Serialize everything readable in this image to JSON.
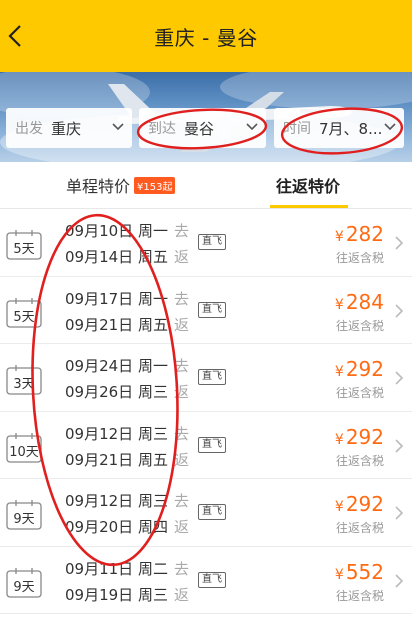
{
  "header": {
    "title": "重庆 - 曼谷"
  },
  "filters": {
    "depart": {
      "label": "出发",
      "value": "重庆"
    },
    "arrive": {
      "label": "到达",
      "value": "曼谷"
    },
    "time": {
      "label": "时间",
      "value": "7月、8..."
    }
  },
  "tabs": {
    "oneway": {
      "label": "单程特价",
      "badge": "¥153起"
    },
    "roundtrip": {
      "label": "往返特价"
    }
  },
  "row_common": {
    "go": "去",
    "back": "返",
    "direct": "直飞",
    "currency": "¥",
    "price_note": "往返含税"
  },
  "rows": [
    {
      "days": "5天",
      "out": "09月10日 周一",
      "ret": "09月14日 周五",
      "price": "282"
    },
    {
      "days": "5天",
      "out": "09月17日 周一",
      "ret": "09月21日 周五",
      "price": "284"
    },
    {
      "days": "3天",
      "out": "09月24日 周一",
      "ret": "09月26日 周三",
      "price": "292"
    },
    {
      "days": "10天",
      "out": "09月12日 周三",
      "ret": "09月21日 周五",
      "price": "292"
    },
    {
      "days": "9天",
      "out": "09月12日 周三",
      "ret": "09月20日 周四",
      "price": "292"
    },
    {
      "days": "9天",
      "out": "09月11日 周二",
      "ret": "09月19日 周三",
      "price": "552"
    }
  ],
  "colors": {
    "brand": "#ffc900",
    "price": "#ff6a13",
    "badge": "#ff5a1f",
    "annotation": "#e0201f"
  },
  "icons": [
    "back-icon",
    "chevron-down-icon",
    "calendar-icon",
    "chevron-right-icon"
  ]
}
